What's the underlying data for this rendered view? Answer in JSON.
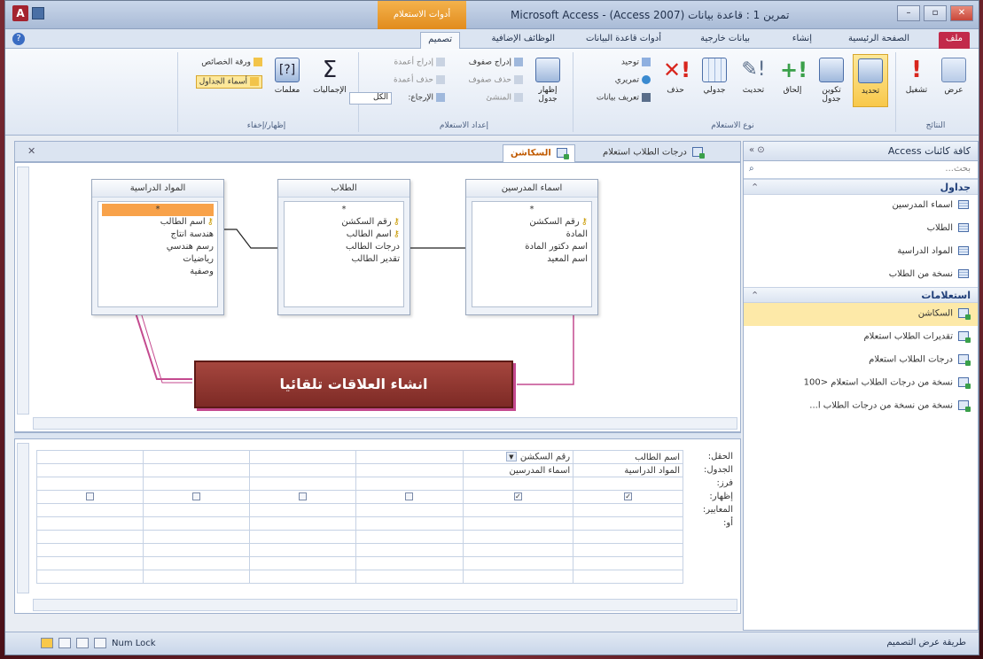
{
  "window": {
    "title": "Microsoft Access - (Access 2007) تمرين 1 : قاعدة بيانات",
    "context_tab": "أدوات الاستعلام",
    "controls": [
      "–",
      "▫",
      "✕"
    ]
  },
  "tabs": [
    "ملف",
    "الصفحة الرئيسية",
    "إنشاء",
    "بيانات خارجية",
    "أدوات قاعدة البيانات",
    "الوظائف الإضافية",
    "تصميم"
  ],
  "ribbon": {
    "results_group": "النتائج",
    "results_buttons": [
      "عرض",
      "تشغيل"
    ],
    "query_type_group": "نوع الاستعلام",
    "query_type_buttons": [
      "تحديد",
      "تكوين جدول",
      "إلحاق",
      "تحديث",
      "جدولي",
      "حذف"
    ],
    "query_type_small": [
      "توحيد",
      "تمريري",
      "تعريف بيانات"
    ],
    "setup_group": "إعداد الاستعلام",
    "setup_big": "إظهار جدول",
    "setup_small": [
      "إدراج صفوف",
      "حذف صفوف",
      "المنشئ",
      "إدراج أعمدة",
      "حذف أعمدة",
      "الإرجاع:"
    ],
    "return_value": "الكل",
    "showhide_group": "إظهار/إخفاء",
    "showhide_buttons": [
      "الإجماليات",
      "معلمات"
    ],
    "showhide_small": [
      "ورقة الخصائص",
      "أسماء الجداول"
    ]
  },
  "nav": {
    "header": "كافة كائنات Access",
    "search_placeholder": "بحث...",
    "tables_group": "جداول",
    "tables": [
      "اسماء المدرسين",
      "الطلاب",
      "المواد الدراسية",
      "نسخة من الطلاب"
    ],
    "queries_group": "استعلامات",
    "queries": [
      "السكاشن",
      "تقديرات الطلاب استعلام",
      "درجات الطلاب استعلام",
      "نسخة من درجات الطلاب استعلام <100",
      "نسخة من نسخة من درجات الطلاب ا..."
    ]
  },
  "doc_tabs": [
    "السكاشن",
    "درجات الطلاب استعلام"
  ],
  "tables_diagram": [
    {
      "title": "المواد الدراسية",
      "fields": [
        "*",
        "اسم الطالب",
        "هندسة انتاج",
        "رسم هندسي",
        "رياضيات",
        "وصفية"
      ],
      "keys": [
        1
      ]
    },
    {
      "title": "الطلاب",
      "fields": [
        "*",
        "رقم السكشن",
        "اسم الطالب",
        "درجات الطالب",
        "تقدير الطالب"
      ],
      "keys": [
        1,
        2
      ]
    },
    {
      "title": "اسماء المدرسين",
      "fields": [
        "*",
        "رقم السكشن",
        "المادة",
        "اسم دكتور المادة",
        "اسم المعيد"
      ],
      "keys": [
        1
      ]
    }
  ],
  "callout": "انشاء العلاقات تلقائيا",
  "grid": {
    "row_labels": [
      "الحقل:",
      "الجدول:",
      "فرز:",
      "إظهار:",
      "المعايير:",
      "أو:"
    ],
    "columns": [
      {
        "field": "اسم الطالب",
        "table": "المواد الدراسية",
        "show": true
      },
      {
        "field": "رقم السكشن",
        "table": "اسماء المدرسين",
        "show": true
      },
      {
        "field": "",
        "table": "",
        "show": false
      },
      {
        "field": "",
        "table": "",
        "show": false
      },
      {
        "field": "",
        "table": "",
        "show": false
      },
      {
        "field": "",
        "table": "",
        "show": false
      }
    ]
  },
  "status": {
    "left": "طريقة عرض التصميم",
    "num_lock": "Num Lock"
  }
}
